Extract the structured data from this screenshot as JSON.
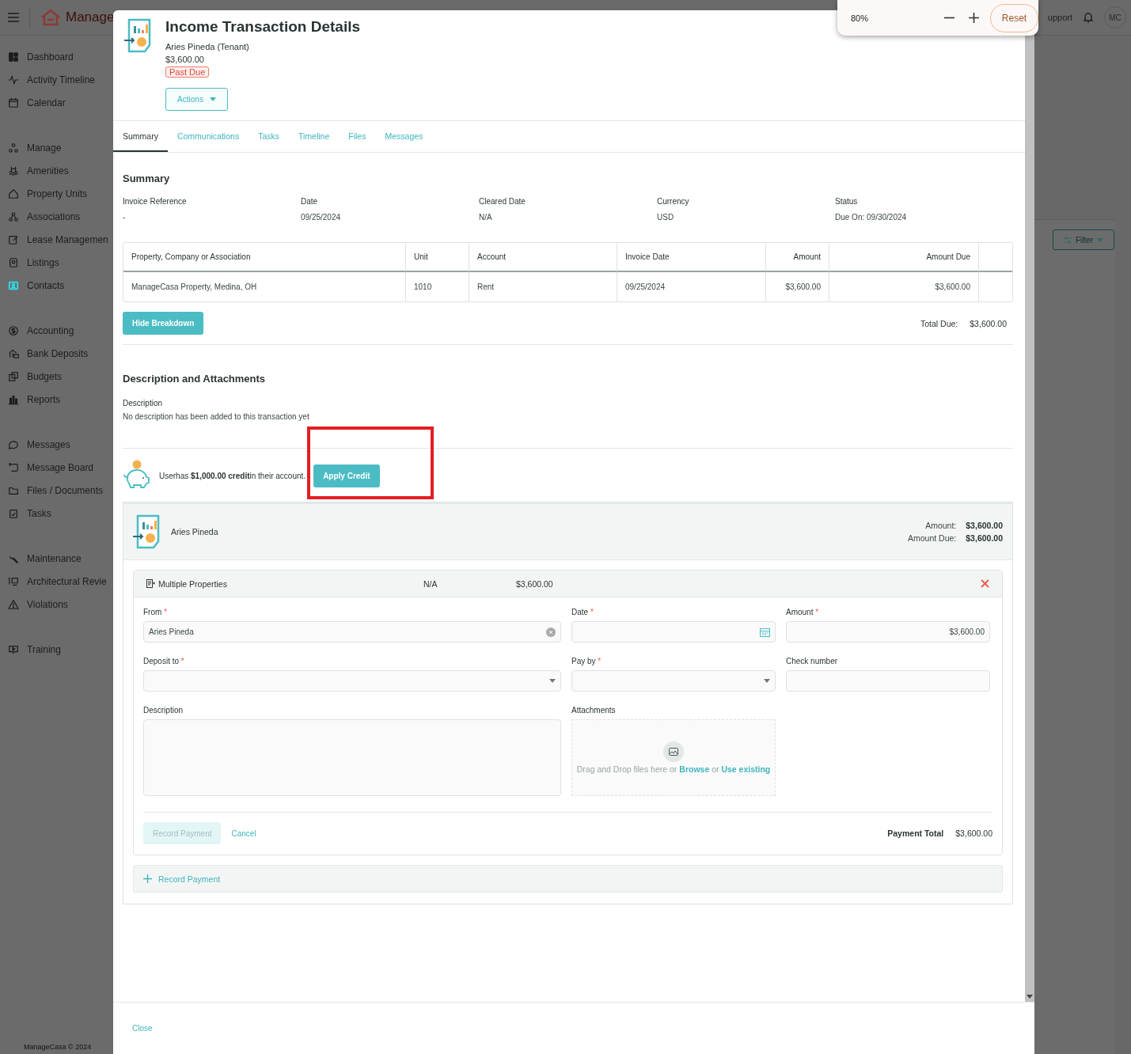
{
  "top_bar": {
    "logo_text": "Manage",
    "support_link": "upport",
    "avatar": "MC"
  },
  "sidebar": {
    "groups": [
      {
        "items": [
          {
            "label": "Dashboard",
            "selected": false
          },
          {
            "label": "Activity Timeline",
            "selected": false
          },
          {
            "label": "Calendar",
            "selected": false
          }
        ]
      },
      {
        "items": [
          {
            "label": "Manage",
            "selected": false
          },
          {
            "label": "Amenities",
            "selected": false
          },
          {
            "label": "Property Units",
            "selected": false
          },
          {
            "label": "Associations",
            "selected": false
          },
          {
            "label": "Lease Managemen",
            "selected": false
          },
          {
            "label": "Listings",
            "selected": false
          },
          {
            "label": "Contacts",
            "selected": true
          }
        ]
      },
      {
        "items": [
          {
            "label": "Accounting",
            "selected": false
          },
          {
            "label": "Bank Deposits",
            "selected": false
          },
          {
            "label": "Budgets",
            "selected": false
          },
          {
            "label": "Reports",
            "selected": false
          }
        ]
      },
      {
        "items": [
          {
            "label": "Messages",
            "selected": false
          },
          {
            "label": "Message Board",
            "selected": false
          },
          {
            "label": "Files / Documents",
            "selected": false
          },
          {
            "label": "Tasks",
            "selected": false
          }
        ]
      },
      {
        "items": [
          {
            "label": "Maintenance",
            "selected": false
          },
          {
            "label": "Architectural Revie",
            "selected": false
          },
          {
            "label": "Violations",
            "selected": false
          }
        ]
      },
      {
        "items": [
          {
            "label": "Training",
            "selected": false
          }
        ]
      }
    ],
    "footer": "ManageCasa © 2024"
  },
  "background": {
    "filter_button": "Filter"
  },
  "zoom_popup": {
    "level": "80%",
    "reset": "Reset"
  },
  "modal": {
    "title": "Income Transaction Details",
    "subtitle": "Aries Pineda (Tenant)",
    "amount": "$3,600.00",
    "status_badge": "Past Due",
    "actions": "Actions",
    "tabs": [
      {
        "label": "Summary",
        "selected": true
      },
      {
        "label": "Communications",
        "selected": false
      },
      {
        "label": "Tasks",
        "selected": false
      },
      {
        "label": "Timeline",
        "selected": false
      },
      {
        "label": "Files",
        "selected": false
      },
      {
        "label": "Messages",
        "selected": false
      }
    ],
    "summary": {
      "heading": "Summary",
      "fields": [
        {
          "label": "Invoice Reference",
          "value": "-"
        },
        {
          "label": "Date",
          "value": "09/25/2024"
        },
        {
          "label": "Cleared Date",
          "value": "N/A"
        },
        {
          "label": "Currency",
          "value": "USD"
        },
        {
          "label": "Status",
          "value": "Due On: 09/30/2024"
        }
      ],
      "table": {
        "columns": [
          "Property, Company or Association",
          "Unit",
          "Account",
          "Invoice Date",
          "Amount",
          "Amount Due"
        ],
        "rows": [
          [
            "ManageCasa Property, Medina, OH",
            "1010",
            "Rent",
            "09/25/2024",
            "$3,600.00",
            "$3,600.00"
          ]
        ]
      },
      "hide_breakdown": "Hide Breakdown",
      "total_label": "Total Due:",
      "total_value": "$3,600.00"
    },
    "description": {
      "heading": "Description and Attachments",
      "label": "Description",
      "text": "No description has been added to this transaction yet"
    },
    "credit": {
      "text": "Userhas **$1,000.00 credit**in their account.",
      "button": "Apply Credit"
    },
    "payer": {
      "name": "Aries Pineda",
      "amount_label": "Amount:",
      "amount": "$3,600.00",
      "due_label": "Amount Due:",
      "amount_due": "$3,600.00"
    },
    "payment": {
      "header": {
        "title": "Multiple Properties",
        "column_2": "N/A",
        "column_3": "$3,600.00"
      },
      "fields": [
        {
          "label": "From",
          "required_mark": "*",
          "kind": "clearable",
          "value": "Aries Pineda"
        },
        {
          "label": "Date",
          "required_mark": "*",
          "kind": "date"
        },
        {
          "label": "Amount",
          "required_mark": "*",
          "kind": "text",
          "value": "$3,600.00"
        },
        {
          "label": "Deposit to",
          "required_mark": "*",
          "kind": "select"
        },
        {
          "label": "Pay by",
          "required_mark": "*",
          "kind": "select"
        },
        {
          "label": "Check number",
          "kind": "text"
        },
        {
          "label": "Description",
          "kind": "textarea"
        },
        {
          "label": "Attachments",
          "kind": "dropzone",
          "text": "Drag and Drop files here or",
          "browse": "Browse",
          "or": "or",
          "use_existing": "Use existing"
        }
      ],
      "record_button": {
        "label": "Record Payment",
        "disabled": true
      },
      "cancel": "Cancel",
      "total_label": "Payment Total",
      "total_value": "$3,600.00"
    },
    "add_payment": "Record Payment",
    "close": "Close"
  }
}
